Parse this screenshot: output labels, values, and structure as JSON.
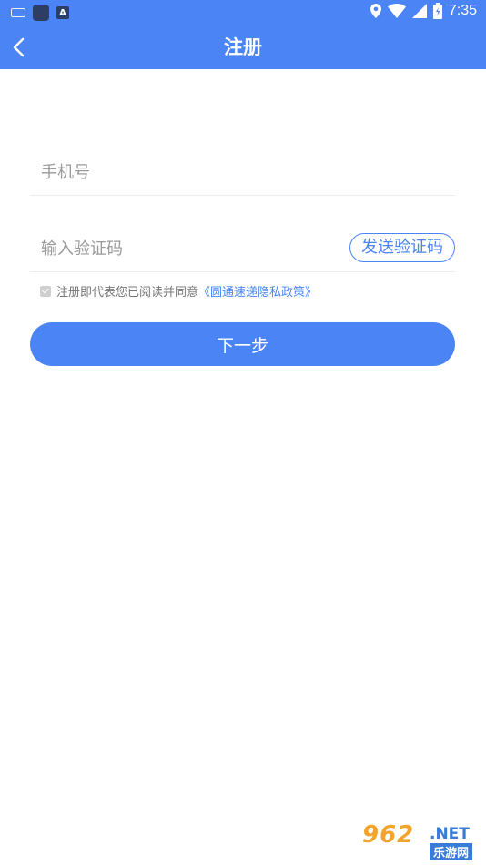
{
  "status_bar": {
    "time": "7:35",
    "icons": [
      "keyboard-icon",
      "app-icon",
      "a-icon",
      "location-icon",
      "wifi-icon",
      "signal-icon",
      "battery-icon"
    ]
  },
  "header": {
    "title": "注册",
    "background_color": "#4a84f5"
  },
  "form": {
    "phone_placeholder": "手机号",
    "code_placeholder": "输入验证码",
    "send_code_label": "发送验证码",
    "agreement_text": "注册即代表您已阅读并同意",
    "policy_link": "《圆通速递隐私政策》",
    "agreement_checked": true,
    "next_label": "下一步"
  },
  "watermark": {
    "main": "962",
    "domain": ".NET",
    "sub": "乐游网"
  },
  "colors": {
    "accent": "#4a84f5",
    "placeholder": "#9a9a9a",
    "divider": "#ececec"
  }
}
